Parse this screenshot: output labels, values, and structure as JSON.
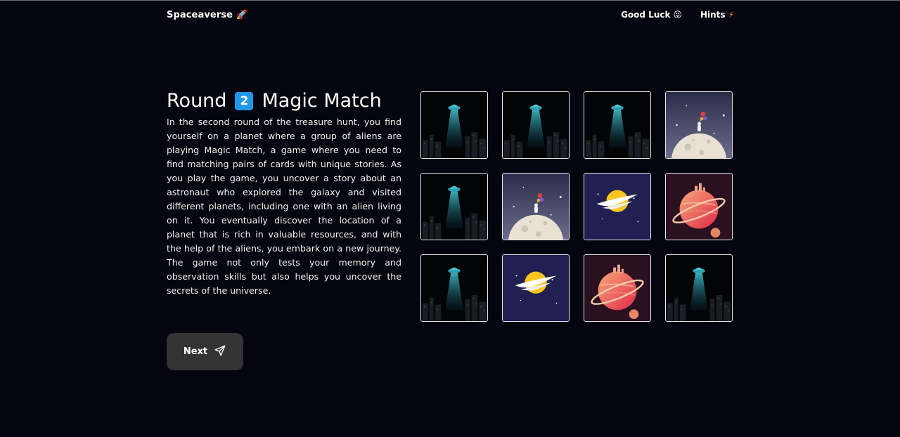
{
  "nav": {
    "brand": "Spaceaverse 🚀",
    "good_luck": "Good Luck",
    "good_luck_emoji": "😝",
    "hints": "Hints",
    "hints_emoji": "⚡"
  },
  "round": {
    "word": "Round",
    "number": "2",
    "name": "Magic Match",
    "badge_color": "#1f96e8"
  },
  "description": "In the second round of the treasure hunt, you find yourself on a planet where a group of aliens are playing Magic Match, a game where you need to find matching pairs of cards with unique stories. As you play the game, you uncover a story about an astronaut who explored the galaxy and visited different planets, including one with an alien living on it. You eventually discover the location of a planet that is rich in valuable resources, and with the help of the aliens, you embark on a new journey. The game not only tests your memory and observation skills but also helps you uncover the secrets of the universe.",
  "next_button": {
    "label": "Next",
    "icon": "send-icon"
  },
  "cards": [
    {
      "image": "ufo"
    },
    {
      "image": "ufo"
    },
    {
      "image": "ufo"
    },
    {
      "image": "moon-astronaut"
    },
    {
      "image": "ufo"
    },
    {
      "image": "moon-astronaut"
    },
    {
      "image": "sun-cloud"
    },
    {
      "image": "ringed-planet"
    },
    {
      "image": "ufo"
    },
    {
      "image": "sun-cloud"
    },
    {
      "image": "ringed-planet"
    },
    {
      "image": "ufo"
    }
  ]
}
